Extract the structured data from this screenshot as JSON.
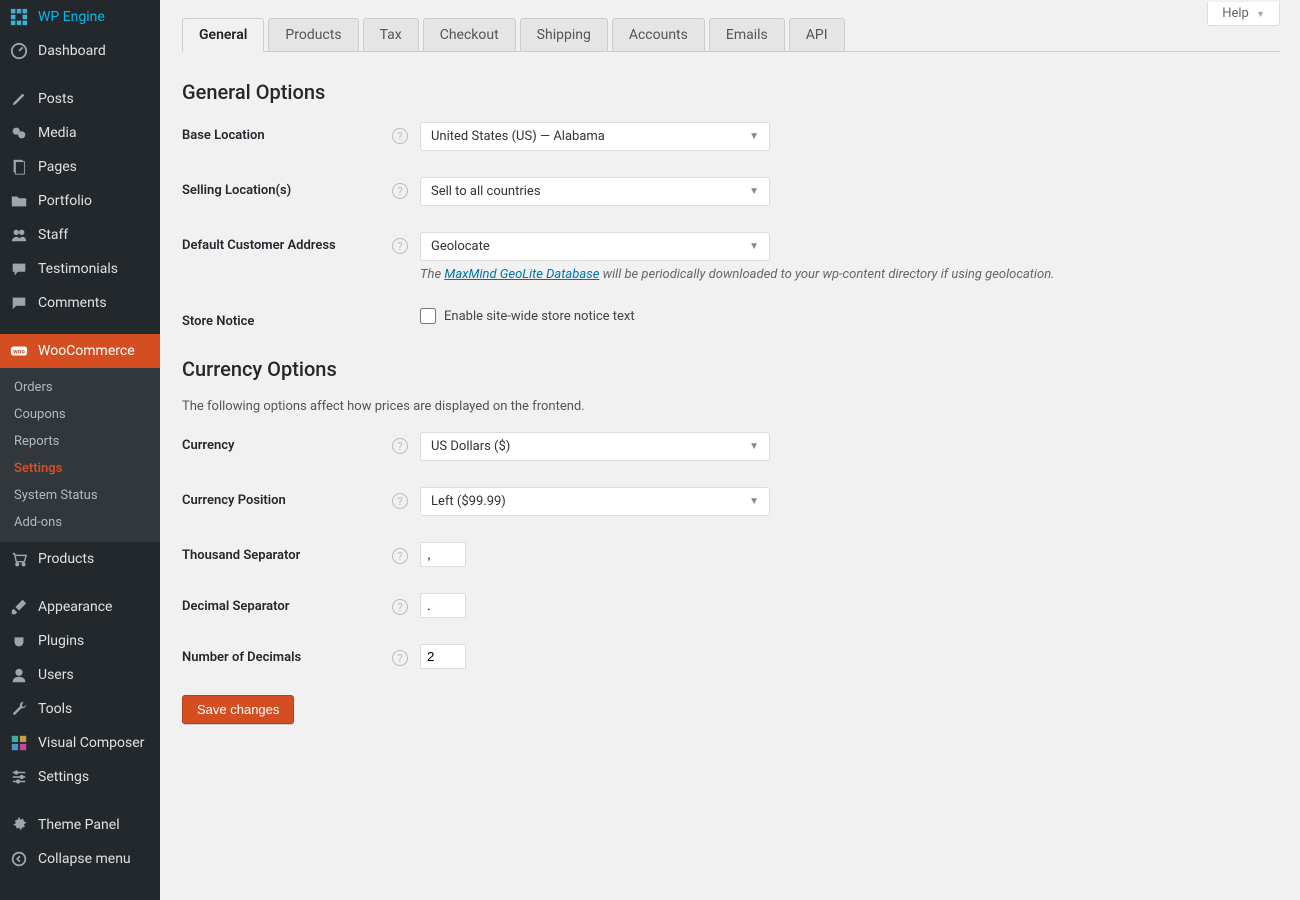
{
  "help_label": "Help",
  "sidebar": {
    "items": [
      {
        "label": "WP Engine",
        "icon": "wpengine"
      },
      {
        "label": "Dashboard",
        "icon": "dashboard"
      },
      {
        "label": "Posts",
        "icon": "pin"
      },
      {
        "label": "Media",
        "icon": "media"
      },
      {
        "label": "Pages",
        "icon": "page"
      },
      {
        "label": "Portfolio",
        "icon": "folder"
      },
      {
        "label": "Staff",
        "icon": "users"
      },
      {
        "label": "Testimonials",
        "icon": "chat"
      },
      {
        "label": "Comments",
        "icon": "comment"
      },
      {
        "label": "WooCommerce",
        "icon": "woo",
        "active": true
      },
      {
        "label": "Products",
        "icon": "cart"
      },
      {
        "label": "Appearance",
        "icon": "brush"
      },
      {
        "label": "Plugins",
        "icon": "plug"
      },
      {
        "label": "Users",
        "icon": "user"
      },
      {
        "label": "Tools",
        "icon": "wrench"
      },
      {
        "label": "Visual Composer",
        "icon": "vc"
      },
      {
        "label": "Settings",
        "icon": "sliders"
      },
      {
        "label": "Theme Panel",
        "icon": "gear"
      },
      {
        "label": "Collapse menu",
        "icon": "collapse"
      }
    ],
    "submenu": [
      {
        "label": "Orders"
      },
      {
        "label": "Coupons"
      },
      {
        "label": "Reports"
      },
      {
        "label": "Settings",
        "current": true
      },
      {
        "label": "System Status"
      },
      {
        "label": "Add-ons"
      }
    ]
  },
  "tabs": [
    "General",
    "Products",
    "Tax",
    "Checkout",
    "Shipping",
    "Accounts",
    "Emails",
    "API"
  ],
  "active_tab": "General",
  "general": {
    "heading": "General Options",
    "base_location": {
      "label": "Base Location",
      "value": "United States (US) — Alabama"
    },
    "selling_locations": {
      "label": "Selling Location(s)",
      "value": "Sell to all countries"
    },
    "default_customer_address": {
      "label": "Default Customer Address",
      "value": "Geolocate",
      "hint_prefix": "The ",
      "hint_link": "MaxMind GeoLite Database",
      "hint_suffix": " will be periodically downloaded to your wp-content directory if using geolocation."
    },
    "store_notice": {
      "label": "Store Notice",
      "checkbox_label": "Enable site-wide store notice text",
      "checked": false
    }
  },
  "currency": {
    "heading": "Currency Options",
    "note": "The following options affect how prices are displayed on the frontend.",
    "currency": {
      "label": "Currency",
      "value": "US Dollars ($)"
    },
    "position": {
      "label": "Currency Position",
      "value": "Left ($99.99)"
    },
    "thousand": {
      "label": "Thousand Separator",
      "value": ","
    },
    "decimal": {
      "label": "Decimal Separator",
      "value": "."
    },
    "num_decimals": {
      "label": "Number of Decimals",
      "value": "2"
    }
  },
  "save_button": "Save changes"
}
